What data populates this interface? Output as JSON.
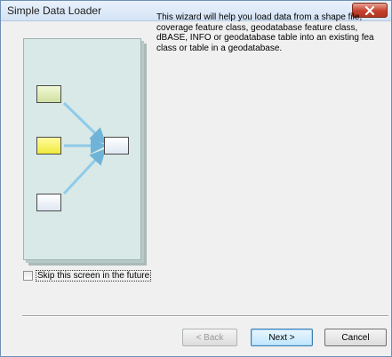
{
  "window": {
    "title": "Simple Data Loader"
  },
  "icons": {
    "close": "close-icon",
    "illustration": "data-loading-illustration"
  },
  "description": "This wizard will help you load data from a shape file,\ncoverage feature class, geodatabase feature class,\ndBASE, INFO or geodatabase table into an existing fea\nclass or table in a geodatabase.",
  "skip_checkbox": {
    "label": "Skip this screen in the future",
    "checked": false
  },
  "buttons": {
    "back": "< Back",
    "back_enabled": false,
    "next": "Next >",
    "cancel": "Cancel"
  },
  "colors": {
    "close_button": "#c4402c",
    "illustration_bg": "#d8e9e7",
    "arrow": "#6fb4d8"
  }
}
